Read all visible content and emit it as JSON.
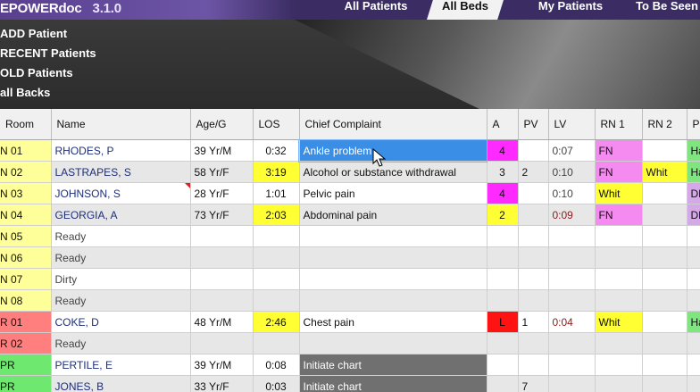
{
  "app": {
    "logo": "EPOWERdoc",
    "version": "3.1.0"
  },
  "tabs": [
    {
      "label": "All Patients",
      "active": false
    },
    {
      "label": "All Beds",
      "active": true
    },
    {
      "label": "My Patients",
      "active": false
    },
    {
      "label": "To Be Seen",
      "active": false
    }
  ],
  "menu": [
    "ADD Patient",
    "RECENT Patients",
    "OLD Patients",
    "all Backs"
  ],
  "table": {
    "headers": [
      "Room",
      "Name",
      "Age/G",
      "LOS",
      "Chief Complaint",
      "A",
      "PV",
      "LV",
      "RN 1",
      "RN 2",
      "P"
    ],
    "rows": [
      {
        "room": "N 01",
        "name": "RHODES, P",
        "age": "39 Yr/M",
        "los": "0:32",
        "cc": "Ankle problem",
        "a": "4",
        "pv": "",
        "lv": "0:07",
        "rn1": "FN",
        "rn2": "",
        "p": "Ha"
      },
      {
        "room": "N 02",
        "name": "LASTRAPES, S",
        "age": "58 Yr/F",
        "los": "3:19",
        "cc": "Alcohol or substance withdrawal",
        "a": "3",
        "pv": "2",
        "lv": "0:10",
        "rn1": "FN",
        "rn2": "Whit",
        "p": "Ha"
      },
      {
        "room": "N 03",
        "name": "JOHNSON, S",
        "age": "28 Yr/F",
        "los": "1:01",
        "cc": "Pelvic pain",
        "a": "4",
        "pv": "",
        "lv": "0:10",
        "rn1": "Whit",
        "rn2": "",
        "p": "DD"
      },
      {
        "room": "N 04",
        "name": "GEORGIA, A",
        "age": "73 Yr/F",
        "los": "2:03",
        "cc": "Abdominal pain",
        "a": "2",
        "pv": "",
        "lv": "0:09",
        "rn1": "FN",
        "rn2": "",
        "p": "DD"
      },
      {
        "room": "N 05",
        "name": "Ready",
        "age": "",
        "los": "",
        "cc": "",
        "a": "",
        "pv": "",
        "lv": "",
        "rn1": "",
        "rn2": "",
        "p": ""
      },
      {
        "room": "N 06",
        "name": "Ready",
        "age": "",
        "los": "",
        "cc": "",
        "a": "",
        "pv": "",
        "lv": "",
        "rn1": "",
        "rn2": "",
        "p": ""
      },
      {
        "room": "N 07",
        "name": "Dirty",
        "age": "",
        "los": "",
        "cc": "",
        "a": "",
        "pv": "",
        "lv": "",
        "rn1": "",
        "rn2": "",
        "p": ""
      },
      {
        "room": "N 08",
        "name": "Ready",
        "age": "",
        "los": "",
        "cc": "",
        "a": "",
        "pv": "",
        "lv": "",
        "rn1": "",
        "rn2": "",
        "p": ""
      },
      {
        "room": "R 01",
        "name": "COKE, D",
        "age": "48 Yr/M",
        "los": "2:46",
        "cc": "Chest pain",
        "a": "L",
        "pv": "1",
        "lv": "0:04",
        "rn1": "Whit",
        "rn2": "",
        "p": "Ha"
      },
      {
        "room": "R 02",
        "name": "Ready",
        "age": "",
        "los": "",
        "cc": "",
        "a": "",
        "pv": "",
        "lv": "",
        "rn1": "",
        "rn2": "",
        "p": ""
      },
      {
        "room": "PR",
        "name": "PERTILE, E",
        "age": "39 Yr/M",
        "los": "0:08",
        "cc": "Initiate chart",
        "a": "",
        "pv": "",
        "lv": "",
        "rn1": "",
        "rn2": "",
        "p": ""
      },
      {
        "room": "PR",
        "name": "JONES, B",
        "age": "33 Yr/F",
        "los": "0:03",
        "cc": "Initiate chart",
        "a": "",
        "pv": "7",
        "lv": "",
        "rn1": "",
        "rn2": "",
        "p": ""
      }
    ]
  },
  "colors": {
    "logo_bg": "#5a3f8f",
    "room_yellow": "#ffff99",
    "room_red": "#ff7f7f",
    "room_green": "#6ee86e",
    "los_yellow": "#ffff33",
    "acuity_magenta": "#ff2aff",
    "acuity_yellow": "#ffff33",
    "acuity_red": "#ff1212",
    "rn_pink": "#f58af0",
    "rn_yellow": "#ffff33",
    "selected_blue": "#3a8ee6",
    "pending_gray": "#707070"
  }
}
